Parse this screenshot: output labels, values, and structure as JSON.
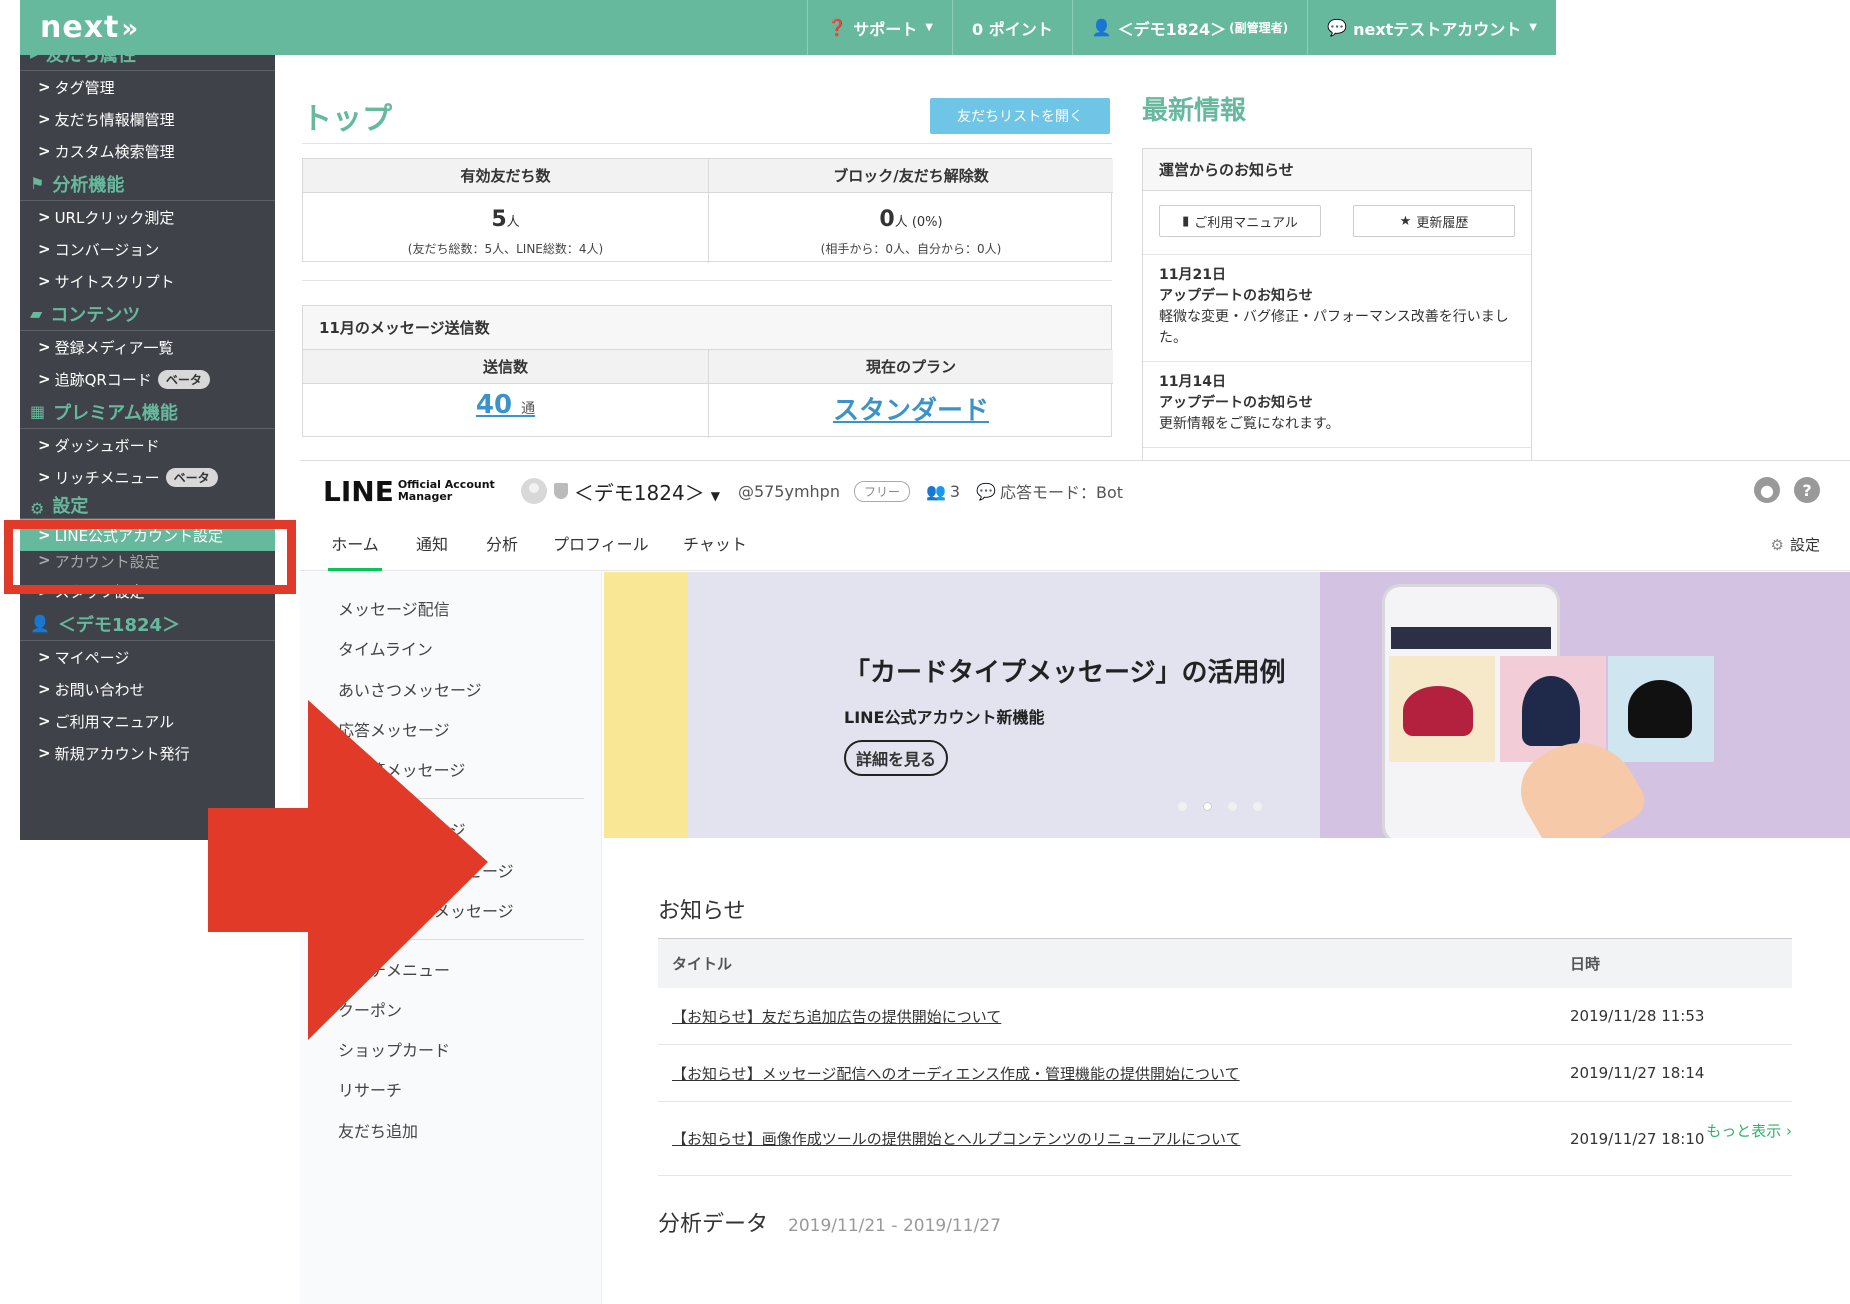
{
  "next_app": {
    "logo": "next",
    "header": {
      "support": "サポート",
      "points": "0 ポイント",
      "user": "＜デモ1824＞",
      "user_role": "(副管理者)",
      "account": "nextテストアカウント"
    },
    "sidebar": {
      "partial_top": "友だち属性",
      "group1": [
        "タグ管理",
        "友だち情報欄管理",
        "カスタム検索管理"
      ],
      "head_analysis": "分析機能",
      "group2": [
        "URLクリック測定",
        "コンバージョン",
        "サイトスクリプト"
      ],
      "head_contents": "コンテンツ",
      "media_list": "登録メディア一覧",
      "qr_code": "追跡QRコード",
      "beta_label": "ベータ",
      "head_premium": "プレミアム機能",
      "dashboard": "ダッシュボード",
      "rich_menu": "リッチメニュー",
      "head_settings": "設定",
      "line_settings": "LINE公式アカウント設定",
      "partial_item": "アカウント設定",
      "staff_settings": "スタッフ設定",
      "head_user": "＜デモ1824＞",
      "group_user": [
        "マイページ",
        "お問い合わせ",
        "ご利用マニュアル",
        "新規アカウント発行"
      ]
    },
    "main": {
      "title": "トップ",
      "friend_list_button": "友だちリストを開く",
      "stats": {
        "valid_friends_label": "有効友だち数",
        "valid_friends_value": "5",
        "valid_friends_unit": "人",
        "valid_friends_sub": "(友だち総数：5人、LINE総数：4人)",
        "blocked_label": "ブロック/友だち解除数",
        "blocked_value": "0",
        "blocked_unit": "人 (0%)",
        "blocked_sub": "(相手から：0人、自分から：0人)"
      },
      "messages": {
        "heading": "11月のメッセージ送信数",
        "sent_label": "送信数",
        "sent_value": "40",
        "sent_unit": "通",
        "plan_label": "現在のプラン",
        "plan_value": "スタンダード"
      }
    },
    "news": {
      "title": "最新情報",
      "box_title": "運営からのお知らせ",
      "manual_button": "ご利用マニュアル",
      "history_button": "更新履歴",
      "entries": [
        {
          "date": "11月21日",
          "title": "アップデートのお知らせ",
          "body": "軽微な変更・バグ修正・パフォーマンス改善を行いました。"
        },
        {
          "date": "11月14日",
          "title": "アップデートのお知らせ",
          "body": "更新情報をご覧になれます。"
        }
      ]
    }
  },
  "line_manager": {
    "logo_big": "LINE",
    "logo_small_1": "Official Account",
    "logo_small_2": "Manager",
    "account_name": "＜デモ1824＞",
    "account_id": "@575ymhpn",
    "plan": "フリー",
    "friends_count": "3",
    "response_mode": "応答モード：Bot",
    "tabs": [
      "ホーム",
      "通知",
      "分析",
      "プロフィール",
      "チャット"
    ],
    "settings": "設定",
    "side_nav": [
      "メッセージ配信",
      "タイムライン",
      "あいさつメッセージ",
      "応答メッセージ",
      "AI応答メッセージ",
      "リッチメッセージ",
      "リッチビデオメッセージ",
      "カードタイプメッセージ",
      "リッチメニュー",
      "クーポン",
      "ショップカード",
      "リサーチ",
      "友だち追加"
    ],
    "banner": {
      "title": "「カードタイプメッセージ」の活用例",
      "subtitle": "LINE公式アカウント新機能",
      "button": "詳細を見る"
    },
    "announcements": {
      "title": "お知らせ",
      "col_title": "タイトル",
      "col_date": "日時",
      "rows": [
        {
          "title": "【お知らせ】友だち追加広告の提供開始について",
          "date": "2019/11/28 11:53"
        },
        {
          "title": "【お知らせ】メッセージ配信へのオーディエンス作成・管理機能の提供開始について",
          "date": "2019/11/27 18:14"
        },
        {
          "title": "【お知らせ】画像作成ツールの提供開始とヘルプコンテンツのリニューアルについて",
          "date": "2019/11/27 18:10"
        }
      ],
      "more": "もっと表示"
    },
    "analytics": {
      "title": "分析データ",
      "range": "2019/11/21 - 2019/11/27"
    }
  },
  "colors": {
    "next_green": "#67b99d",
    "sidebar_bg": "#3f4249",
    "annotation_red": "#e23a28",
    "line_green": "#06c755"
  }
}
